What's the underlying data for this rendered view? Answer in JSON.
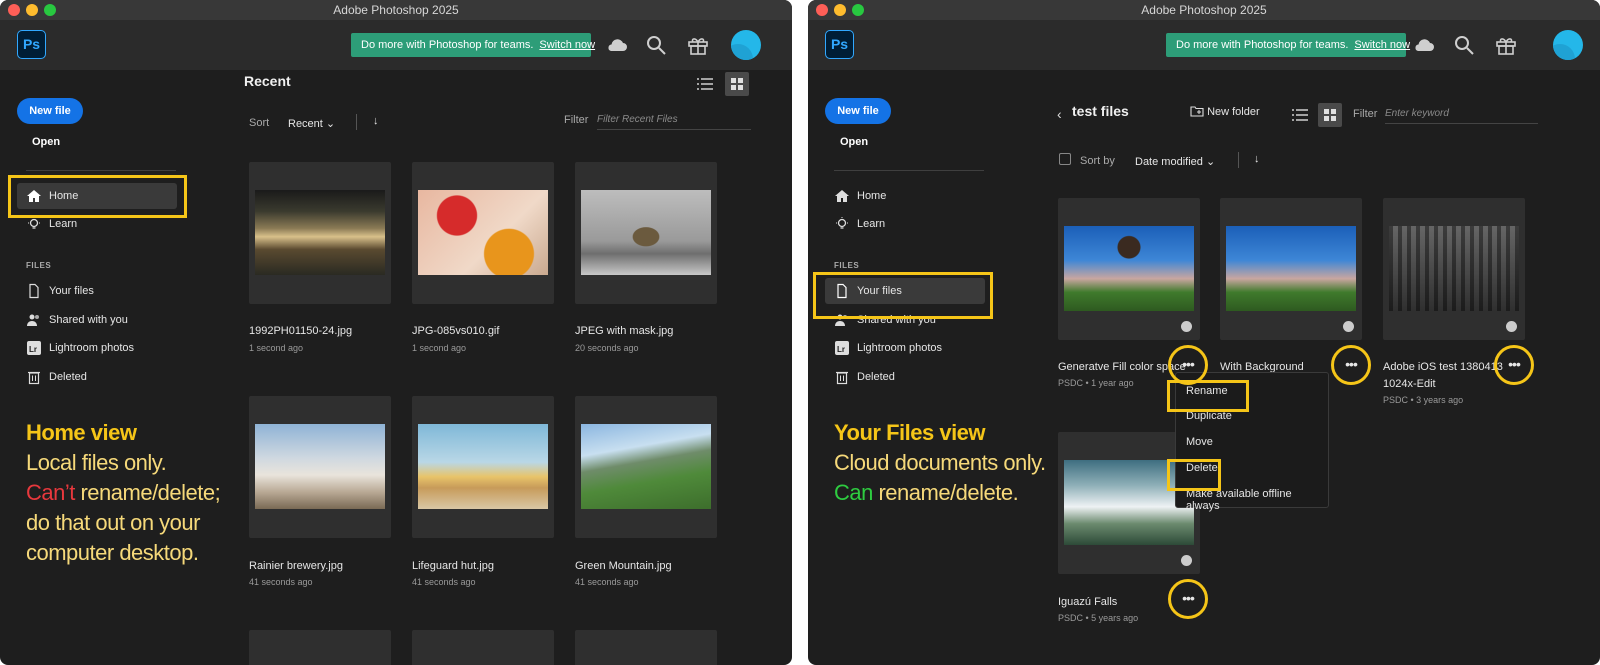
{
  "app": {
    "title": "Adobe Photoshop 2025",
    "logo_text": "Ps"
  },
  "promo": {
    "text": "Do more with Photoshop for teams.",
    "link": "Switch now"
  },
  "header_icons": [
    "cloud-icon",
    "search-icon",
    "gift-icon",
    "avatar"
  ],
  "sidebar": {
    "new_file": "New file",
    "open": "Open",
    "home": "Home",
    "learn": "Learn",
    "files_header": "FILES",
    "your_files": "Your files",
    "shared": "Shared with you",
    "lightroom": "Lightroom photos",
    "deleted": "Deleted"
  },
  "left": {
    "heading": "Recent",
    "sort_label": "Sort",
    "sort_value": "Recent",
    "filter_label": "Filter",
    "filter_placeholder": "Filter Recent Files",
    "files": [
      {
        "name": "1992PH01150-24.jpg",
        "meta": "1 second ago"
      },
      {
        "name": "JPG-085vs010.gif",
        "meta": "1 second ago"
      },
      {
        "name": "JPEG with mask.jpg",
        "meta": "20 seconds ago"
      },
      {
        "name": "Rainier brewery.jpg",
        "meta": "41 seconds ago"
      },
      {
        "name": "Lifeguard hut.jpg",
        "meta": "41 seconds ago"
      },
      {
        "name": "Green Mountain.jpg",
        "meta": "41 seconds ago"
      }
    ],
    "note": {
      "heading": "Home view",
      "line1": "Local files only.",
      "line2_neg": "Can’t",
      "line2_rest": " rename/delete;",
      "line3": "do that out on your",
      "line4": "computer desktop."
    }
  },
  "right": {
    "folder_title": "test files",
    "new_folder": "New folder",
    "filter_label": "Filter",
    "filter_placeholder": "Enter keyword",
    "sort_label": "Sort by",
    "sort_value": "Date modified",
    "files": [
      {
        "name": "Generatve Fill color space",
        "meta": "PSDC • 1 year ago"
      },
      {
        "name": "With Background",
        "meta": ""
      },
      {
        "name": "Adobe iOS test 1380413",
        "name2": "1024x-Edit",
        "meta": "PSDC • 3 years ago"
      },
      {
        "name": "Iguazú Falls",
        "meta": "PSDC • 5 years ago"
      }
    ],
    "menu": [
      "Rename",
      "Duplicate",
      "Move",
      "Delete",
      "Make available offline always"
    ],
    "note": {
      "heading": "Your Files view",
      "line1": "Cloud documents only.",
      "line2_pos": "Can",
      "line2_rest": " rename/delete."
    }
  },
  "colors": {
    "accent": "#1473e6",
    "promo": "#2d9d78",
    "highlight": "#f5c518",
    "negative": "#e8383d",
    "positive": "#2ecc40"
  }
}
